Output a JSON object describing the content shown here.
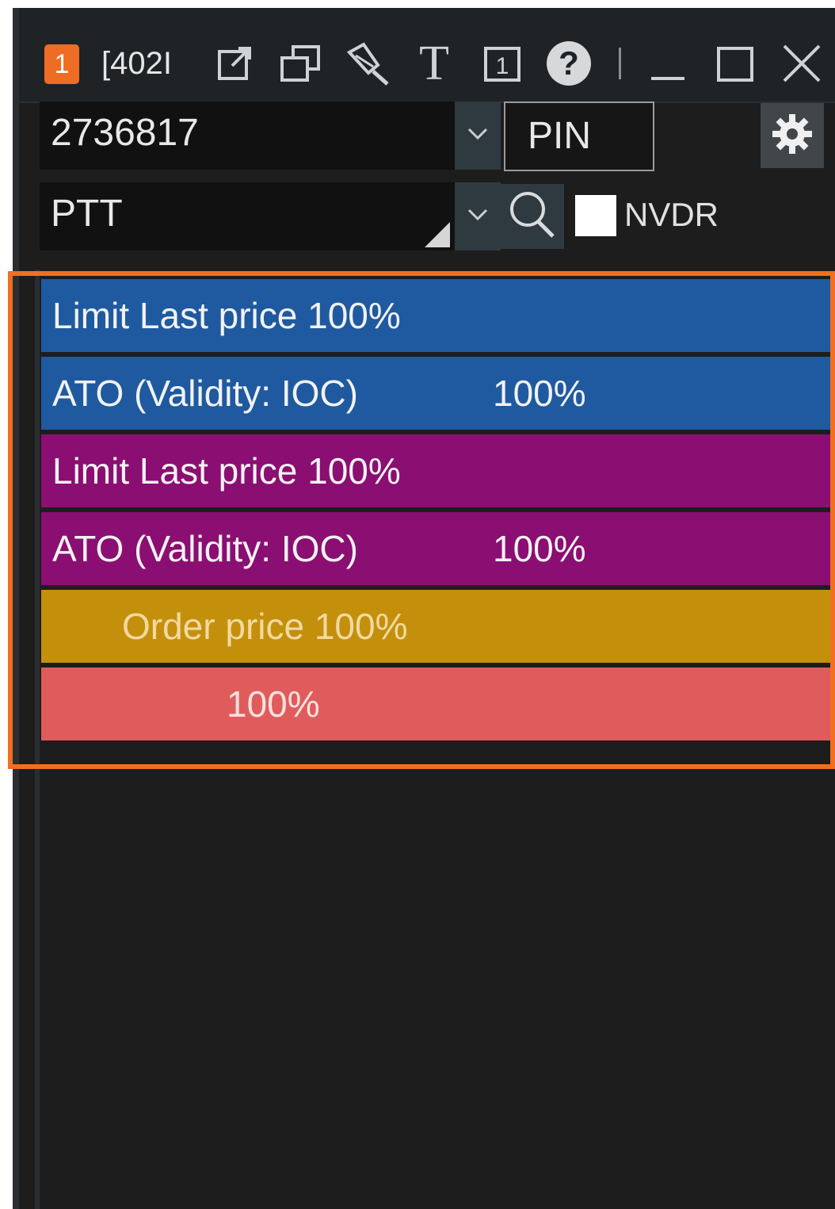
{
  "window": {
    "badge": "1",
    "title": "[402I",
    "toolbar_icons": [
      "popout-icon",
      "duplicate-window-icon",
      "pin-tool-icon",
      "text-icon",
      "link-1-icon",
      "help-icon",
      "separator",
      "minimize-icon",
      "maximize-icon",
      "close-icon"
    ],
    "text_tool_glyph": "T",
    "link_glyph": "1",
    "help_glyph": "?"
  },
  "account": {
    "value": "2736817",
    "pin_label": "PIN"
  },
  "symbol": {
    "value": "PTT",
    "nvdr_label": "NVDR",
    "nvdr_checked": false
  },
  "order_rows": [
    {
      "text": "Limit  Last price 100%",
      "extra": "",
      "color": "#1f5aa0"
    },
    {
      "text": "ATO (Validity: IOC)",
      "extra": "100%",
      "color": "#1f5aa0"
    },
    {
      "text": "Limit  Last price 100%",
      "extra": "",
      "color": "#8b0e72"
    },
    {
      "text": "ATO (Validity: IOC)",
      "extra": "100%",
      "color": "#8b0e72"
    },
    {
      "text": "Order price 100%",
      "extra": "",
      "color": "#c4900c"
    },
    {
      "text": "100%",
      "extra": "",
      "color": "#e05c5c"
    }
  ],
  "colors": {
    "highlight": "#f07020",
    "panel_bg": "#1d1d1d",
    "badge": "#ef6c24"
  }
}
